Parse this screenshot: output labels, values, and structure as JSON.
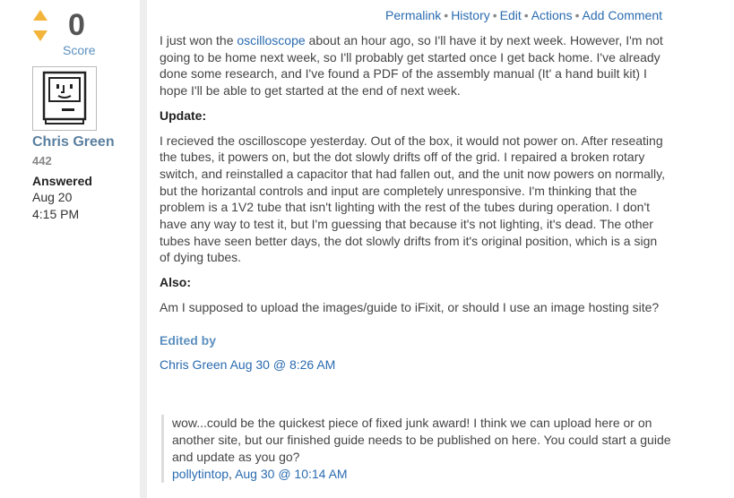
{
  "vote": {
    "score": "0",
    "score_label": "Score"
  },
  "author": {
    "name": "Chris Green",
    "reputation": "442"
  },
  "meta": {
    "answered_label": "Answered",
    "date": "Aug 20",
    "time": "4:15 PM"
  },
  "actions": [
    "Permalink",
    "History",
    "Edit",
    "Actions",
    "Add Comment"
  ],
  "body": {
    "p1_before": "I just won the ",
    "p1_link": "oscilloscope",
    "p1_after": " about an hour ago, so I'll have it by next week. However, I'm not going to be home next week, so I'll probably get started once I get back home. I've already done some research, and I've found a PDF of the assembly manual (It' a hand built kit) I hope I'll be able to get started at the end of next week.",
    "update_heading": "Update:",
    "p2": "I recieved the oscilloscope yesterday. Out of the box, it would not power on. After reseating the tubes, it powers on, but the dot slowly drifts off of the grid. I repaired a broken rotary switch, and reinstalled a capacitor that had fallen out, and the unit now powers on normally, but the horizantal controls and input are completely unresponsive. I'm thinking that the problem is a 1V2 tube that isn't lighting with the rest of the tubes during operation. I don't have any way to test it, but I'm guessing that because it's not lighting, it's dead. The other tubes have seen better days, the dot slowly drifts from it's original position, which is a sign of dying tubes.",
    "also_heading": "Also:",
    "p3": "Am I supposed to upload the images/guide to iFixit, or should I use an image hosting site?"
  },
  "edit": {
    "label": "Edited by",
    "editor": "Chris Green",
    "date": "Aug 30 @ 8:26 AM"
  },
  "comment": {
    "text": "wow...could be the quickest piece of fixed junk award! I think we can upload here or on another site, but our finished guide needs to be published on here. You could start a guide and update as you go?",
    "user": "pollytintop",
    "date": "Aug 30 @ 10:14 AM"
  },
  "colors": {
    "accent": "#2a6bb0",
    "vote_arrow": "#f2b43a",
    "score_label": "#5b8fbf",
    "author": "#5a7f9f"
  }
}
